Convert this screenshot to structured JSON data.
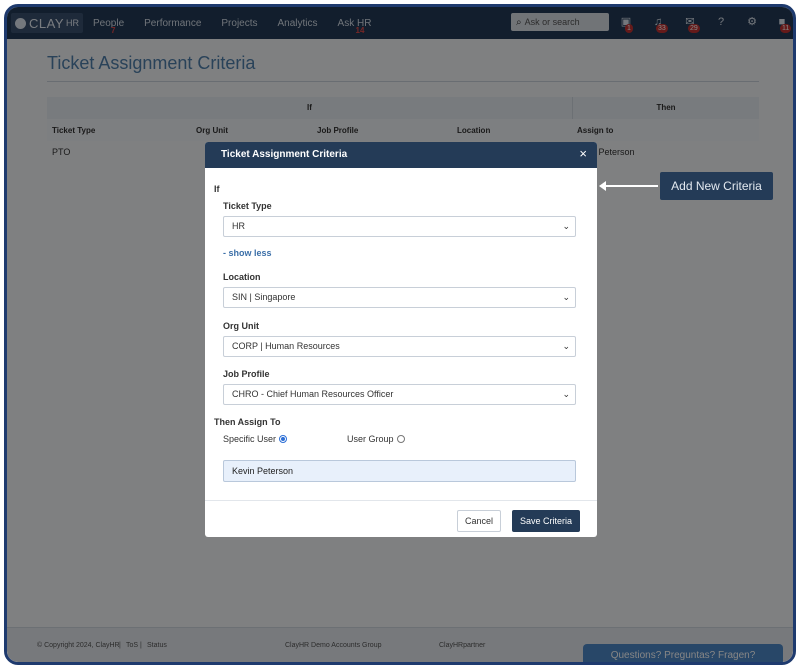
{
  "app": {
    "logo_text": "CLAY",
    "logo_suffix": "HR"
  },
  "nav": [
    {
      "label": "People",
      "badge": "7"
    },
    {
      "label": "Performance",
      "badge": ""
    },
    {
      "label": "Projects",
      "badge": ""
    },
    {
      "label": "Analytics",
      "badge": ""
    },
    {
      "label": "Ask HR",
      "badge": "14"
    }
  ],
  "search": {
    "placeholder": "Ask or search"
  },
  "top_icons": [
    {
      "icon": "box-icon",
      "badge": "1"
    },
    {
      "icon": "bell-icon",
      "badge": "33"
    },
    {
      "icon": "mail-icon",
      "badge": "29"
    },
    {
      "icon": "help-icon",
      "badge": ""
    },
    {
      "icon": "gear-icon",
      "badge": ""
    },
    {
      "icon": "user-icon",
      "badge": "11"
    }
  ],
  "page": {
    "title": "Ticket Assignment Criteria",
    "table": {
      "group_if": "If",
      "group_then": "Then",
      "headers": [
        "Ticket Type",
        "Org Unit",
        "Job Profile",
        "Location",
        "Assign to"
      ],
      "rows": [
        {
          "ticket_type": "PTO",
          "assign_to": "n Peterson"
        }
      ]
    },
    "add_button": "Add New Criteria"
  },
  "footer": {
    "copyright": "© Copyright 2024, ClayHR",
    "tos": "ToS",
    "status": "Status",
    "company": "ClayHR Demo Accounts Group",
    "partner": "ClayHRpartner",
    "help": "Questions? Preguntas? Fragen?"
  },
  "modal": {
    "title": "Ticket Assignment Criteria",
    "close_glyph": "×",
    "if_label": "If",
    "ticket_type": {
      "label": "Ticket Type",
      "value": "HR"
    },
    "show_less": "- show less",
    "location": {
      "label": "Location",
      "value": "SIN | Singapore"
    },
    "org_unit": {
      "label": "Org Unit",
      "value": "CORP | Human Resources"
    },
    "job_profile": {
      "label": "Job Profile",
      "value": "CHRO - Chief Human Resources Officer"
    },
    "assign_to_label": "Then Assign To",
    "radio_specific_user": "Specific User",
    "radio_user_group": "User Group",
    "selected_radio": "specific_user",
    "user_value": "Kevin Peterson",
    "cancel": "Cancel",
    "save": "Save Criteria"
  }
}
